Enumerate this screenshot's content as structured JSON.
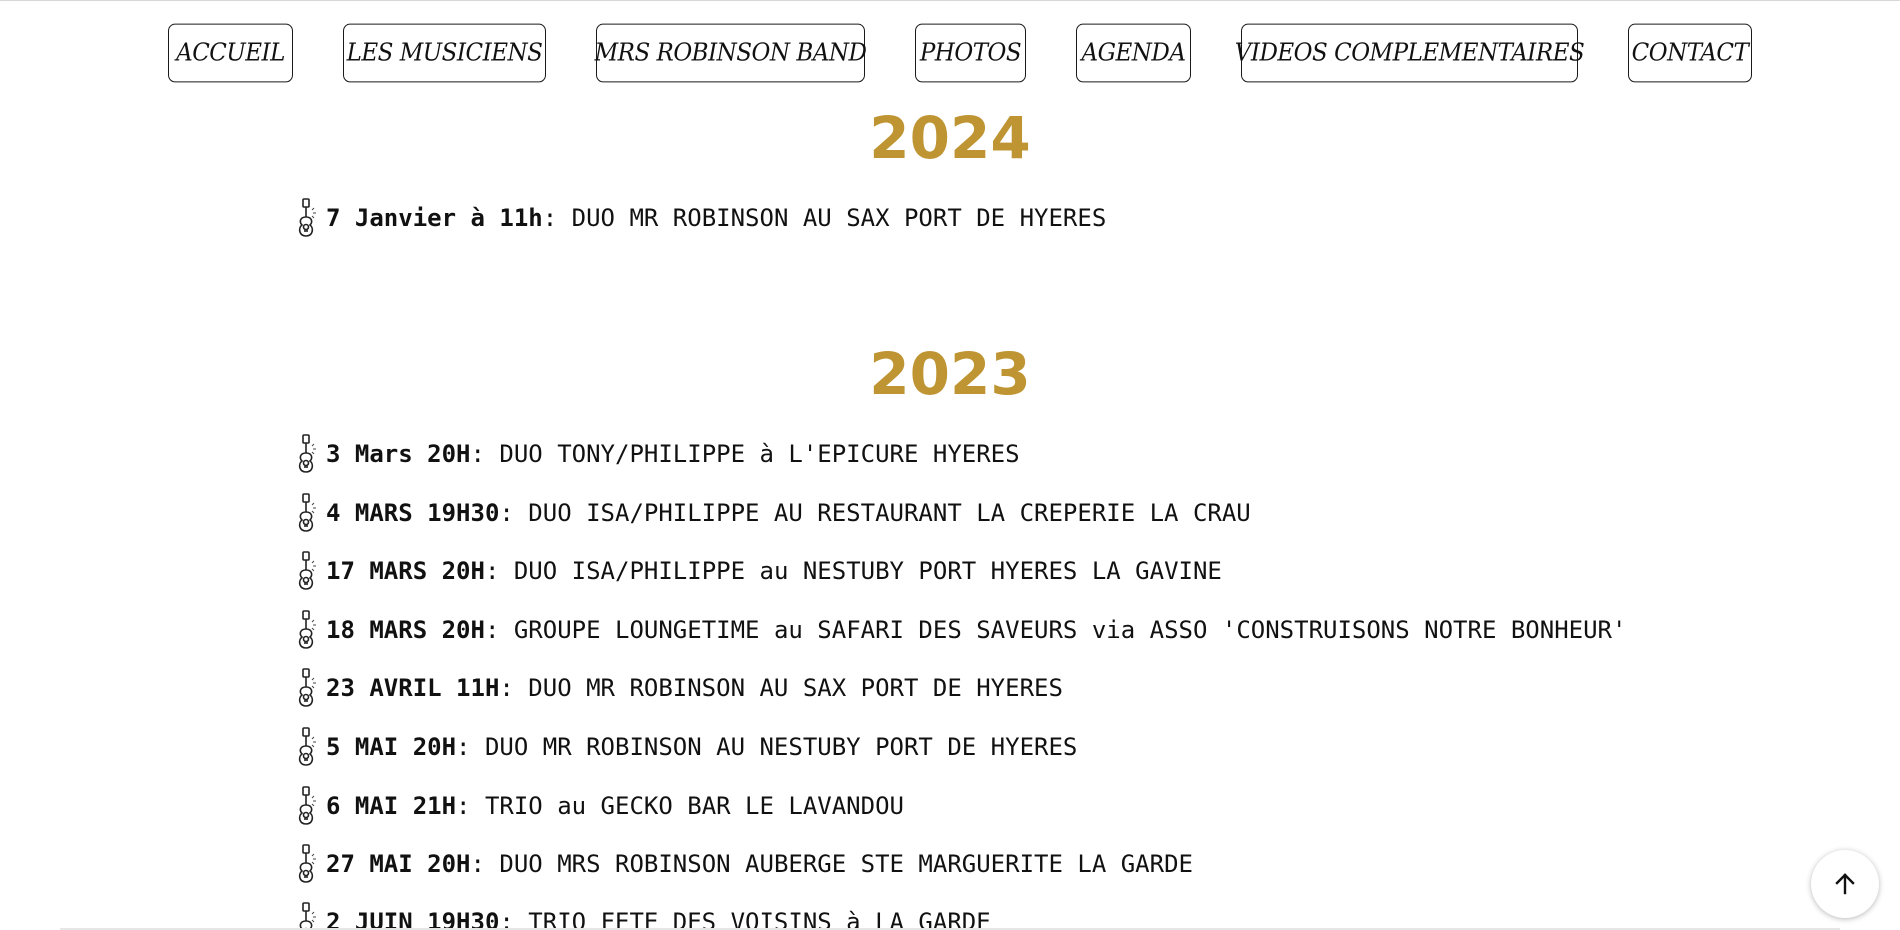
{
  "nav": {
    "items": [
      {
        "label": "ACCUEIL"
      },
      {
        "label": "LES MUSICIENS"
      },
      {
        "label": "MRS ROBINSON BAND"
      },
      {
        "label": "PHOTOS"
      },
      {
        "label": "AGENDA"
      },
      {
        "label": "VIDEOS COMPLEMENTAIRES"
      },
      {
        "label": "CONTACT"
      }
    ]
  },
  "agenda": {
    "sections": [
      {
        "year": "2024",
        "events": [
          {
            "date": "7 Janvier à 11h",
            "sep": ":",
            "text": " DUO MR ROBINSON AU SAX PORT DE HYERES"
          }
        ]
      },
      {
        "year": "2023",
        "events": [
          {
            "date": "3 Mars 20H",
            "sep": ":",
            "text": " DUO TONY/PHILIPPE à L'EPICURE HYERES"
          },
          {
            "date": "4 MARS 19H30",
            "sep": ":",
            "text": " DUO ISA/PHILIPPE AU RESTAURANT LA CREPERIE LA CRAU"
          },
          {
            "date": "17 MARS 20H",
            "sep": ":",
            "text": " DUO ISA/PHILIPPE au NESTUBY PORT HYERES LA GAVINE"
          },
          {
            "date": "18 MARS 20H",
            "sep": ":",
            "text": " GROUPE LOUNGETIME au SAFARI DES SAVEURS via ASSO 'CONSTRUISONS NOTRE BONHEUR'"
          },
          {
            "date": "23 AVRIL 11H",
            "sep": ":",
            "text": " DUO MR ROBINSON AU SAX PORT DE HYERES"
          },
          {
            "date": "5 MAI 20H",
            "sep": ":",
            "text": " DUO MR ROBINSON AU NESTUBY PORT DE HYERES"
          },
          {
            "date": "6 MAI 21H",
            "sep": ":",
            "text": " TRIO au GECKO BAR LE LAVANDOU"
          },
          {
            "date": "27 MAI 20H",
            "sep": ":",
            "text": " DUO MRS ROBINSON AUBERGE STE MARGUERITE LA GARDE"
          },
          {
            "date": "2 JUIN 19H30",
            "sep": ":",
            "text": " TRIO FETE DES VOISINS à LA GARDE"
          }
        ]
      }
    ]
  },
  "icons": {
    "event_bullet": "guitar-icon",
    "scroll_top": "arrow-up-icon"
  },
  "colors": {
    "year_accent": "#bf9533",
    "text": "#111111",
    "background": "#ffffff"
  }
}
